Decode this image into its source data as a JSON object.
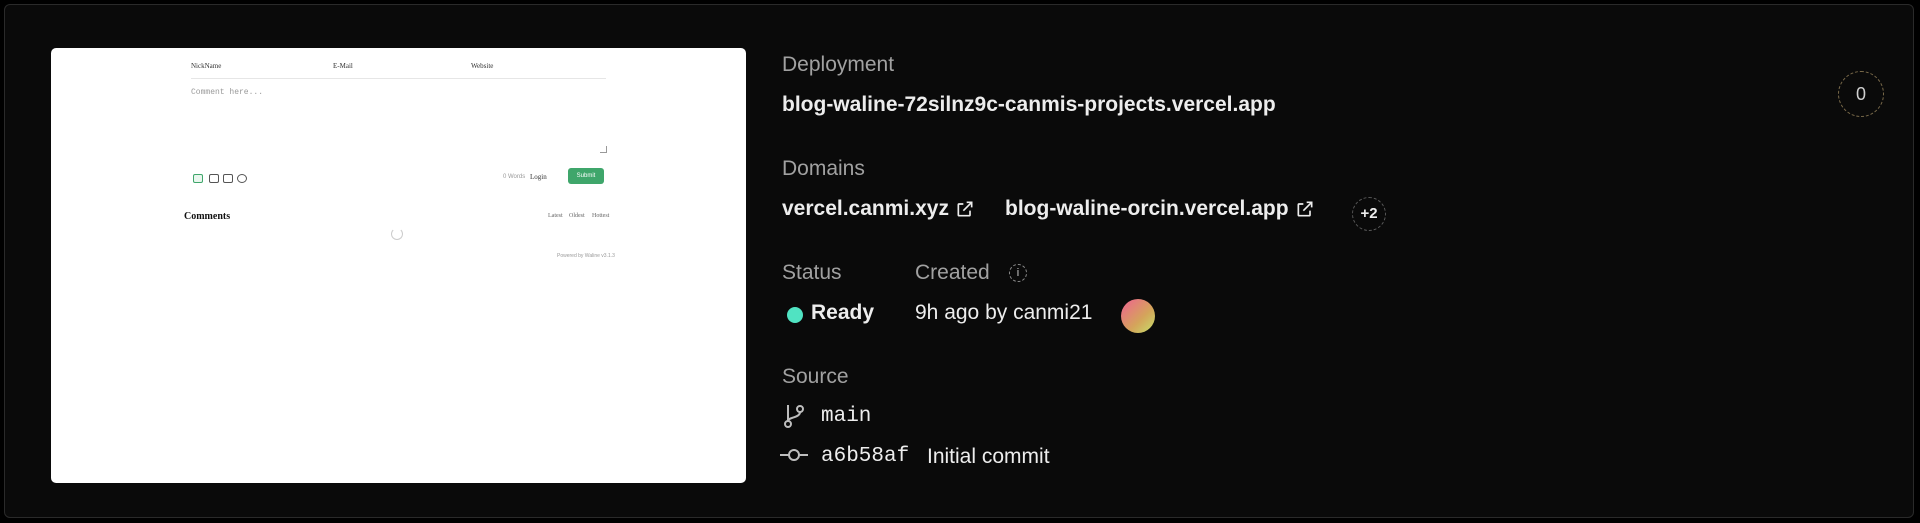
{
  "preview": {
    "nickname_label": "NickName",
    "email_label": "E-Mail",
    "website_label": "Website",
    "comment_placeholder": "Comment here...",
    "words_label": "0 Words",
    "login_label": "Login",
    "submit_label": "Submit",
    "comments_title": "Comments",
    "sort_latest": "Latest",
    "sort_oldest": "Oldest",
    "sort_hottest": "Hottest",
    "powered_by": "Powered by Waline v3.1.3"
  },
  "deployment": {
    "label": "Deployment",
    "url": "blog-waline-72silnz9c-canmis-projects.vercel.app"
  },
  "domains": {
    "label": "Domains",
    "items": [
      "vercel.canmi.xyz",
      "blog-waline-orcin.vercel.app"
    ],
    "more": "+2"
  },
  "status": {
    "label": "Status",
    "value": "Ready",
    "color": "#50e3c2"
  },
  "created": {
    "label": "Created",
    "value": "9h ago by canmi21"
  },
  "source": {
    "label": "Source",
    "branch": "main",
    "commit_hash": "a6b58af",
    "commit_message": "Initial commit"
  },
  "counter": {
    "value": "0"
  }
}
